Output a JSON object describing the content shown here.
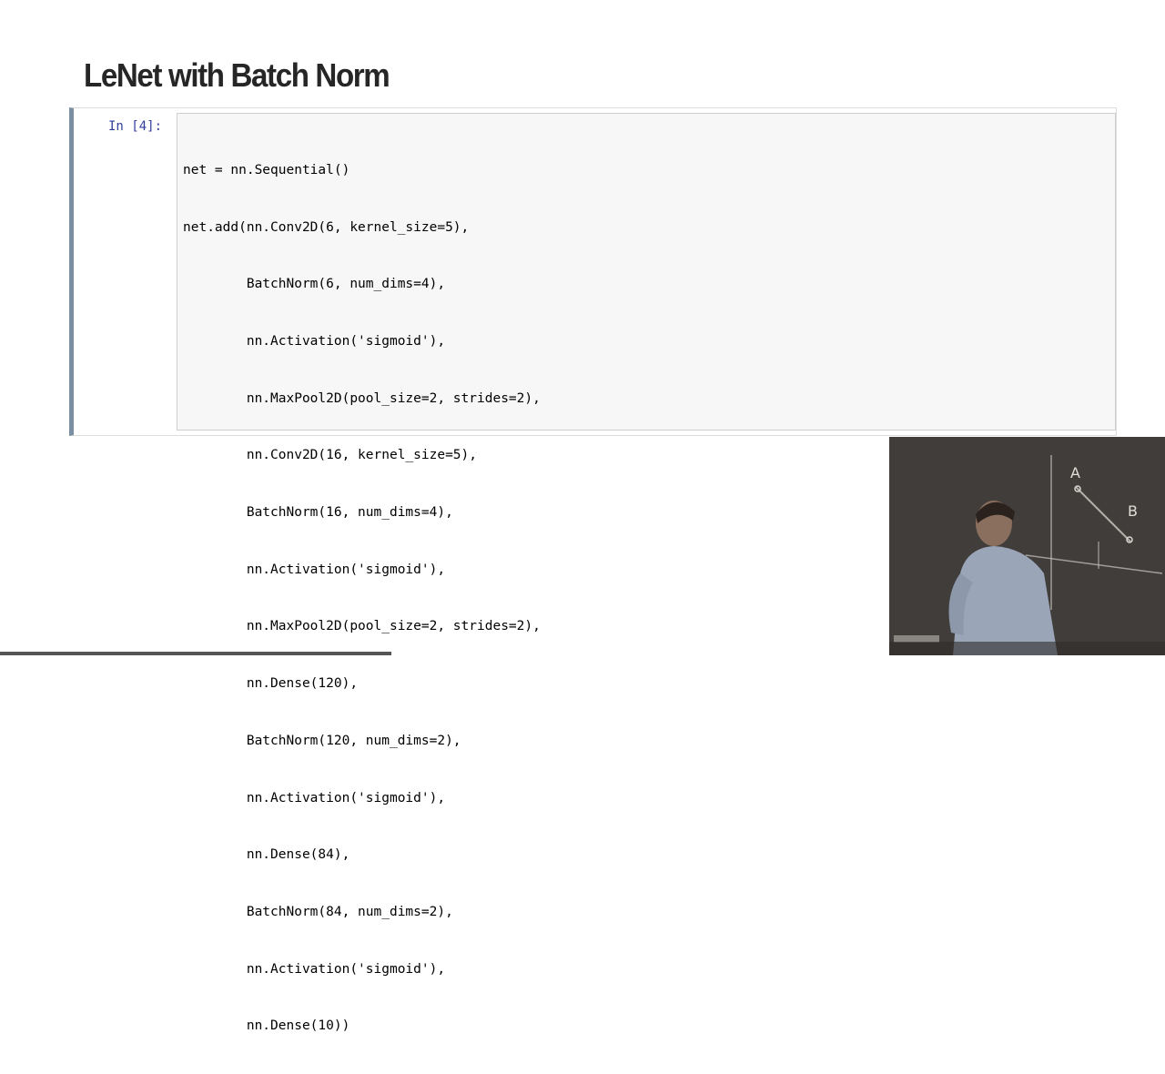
{
  "slide": {
    "title": "LeNet with Batch Norm"
  },
  "cell": {
    "prompt": "In [4]:",
    "code_lines": [
      "net = nn.Sequential()",
      "net.add(nn.Conv2D(6, kernel_size=5),",
      "        BatchNorm(6, num_dims=4),",
      "        nn.Activation('sigmoid'),",
      "        nn.MaxPool2D(pool_size=2, strides=2),",
      "        nn.Conv2D(16, kernel_size=5),",
      "        BatchNorm(16, num_dims=4),",
      "        nn.Activation('sigmoid'),",
      "        nn.MaxPool2D(pool_size=2, strides=2),",
      "        nn.Dense(120),",
      "        BatchNorm(120, num_dims=2),",
      "        nn.Activation('sigmoid'),",
      "        nn.Dense(84),",
      "        BatchNorm(84, num_dims=2),",
      "        nn.Activation('sigmoid'),",
      "        nn.Dense(10))"
    ]
  },
  "video": {
    "board_letters": [
      "A",
      "B"
    ]
  },
  "colors": {
    "prompt": "#303f9f",
    "cell_border_active": "#7b8fa3",
    "code_bg": "#f7f7f7",
    "title": "#262626"
  }
}
